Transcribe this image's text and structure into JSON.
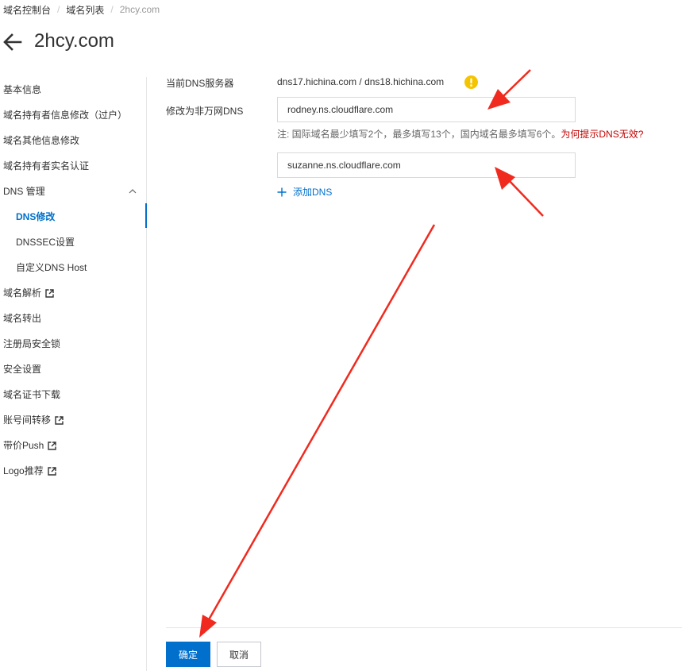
{
  "breadcrumb": {
    "items": [
      "域名控制台",
      "域名列表",
      "2hcy.com"
    ],
    "separator": "/"
  },
  "header": {
    "back_icon": "arrow-left-icon",
    "title": "2hcy.com"
  },
  "sidebar": {
    "items": [
      {
        "label": "基本信息"
      },
      {
        "label": "域名持有者信息修改（过户）"
      },
      {
        "label": "域名其他信息修改"
      },
      {
        "label": "域名持有者实名认证"
      },
      {
        "label": "DNS 管理",
        "expanded": true
      },
      {
        "label": "DNS修改",
        "active": true
      },
      {
        "label": "DNSSEC设置"
      },
      {
        "label": "自定义DNS Host"
      },
      {
        "label": "域名解析",
        "external": true
      },
      {
        "label": "域名转出"
      },
      {
        "label": "注册局安全锁"
      },
      {
        "label": "安全设置"
      },
      {
        "label": "域名证书下载"
      },
      {
        "label": "账号间转移",
        "external": true
      },
      {
        "label": "带价Push",
        "external": true
      },
      {
        "label": "Logo推荐",
        "external": true
      }
    ]
  },
  "form": {
    "current_dns_label": "当前DNS服务器",
    "current_dns_value": "dns17.hichina.com / dns18.hichina.com",
    "modify_label": "修改为非万网DNS",
    "ns_inputs": [
      {
        "value": "rodney.ns.cloudflare.com"
      },
      {
        "value": "suzanne.ns.cloudflare.com"
      }
    ],
    "note_text": "注:  国际域名最少填写2个，最多填写13个，国内域名最多填写6个。",
    "note_link": "为何提示DNS无效?",
    "add_dns_label": "添加DNS"
  },
  "footer": {
    "confirm_label": "确定",
    "cancel_label": "取消"
  },
  "colors": {
    "primary": "#0070cc",
    "warning": "#f5c400",
    "note_link": "#c40000",
    "annotation_arrow": "#f02a1e"
  }
}
